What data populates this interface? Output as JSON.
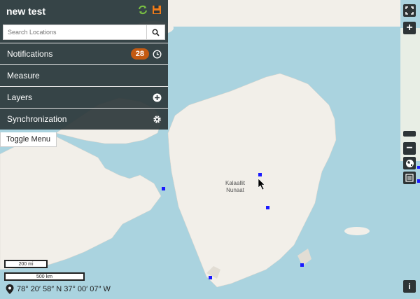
{
  "panel": {
    "title": "new test",
    "search_placeholder": "Search Locations",
    "menu": [
      {
        "label": "Notifications",
        "badge": "28"
      },
      {
        "label": "Measure"
      },
      {
        "label": "Layers"
      },
      {
        "label": "Synchronization"
      }
    ],
    "toggle_label": "Toggle Menu"
  },
  "map": {
    "place_label_line1": "Kalaallit",
    "place_label_line2": "Nunaat",
    "scale_imperial": "200 mi",
    "scale_metric": "500 km",
    "coordinates": "78° 20′ 58″ N 37° 00′ 07″ W"
  },
  "colors": {
    "panel_bg": "#2d373a",
    "badge": "#c35a12",
    "sync_icon": "#7ac143",
    "save_icon": "#f07c1a",
    "marker": "#1a1aff",
    "water": "#aad3df",
    "land": "#f2efe9"
  },
  "controls": {
    "fullscreen_icon": "expand-icon",
    "zoom_in": "+",
    "zoom_out": "−",
    "info": "i"
  }
}
